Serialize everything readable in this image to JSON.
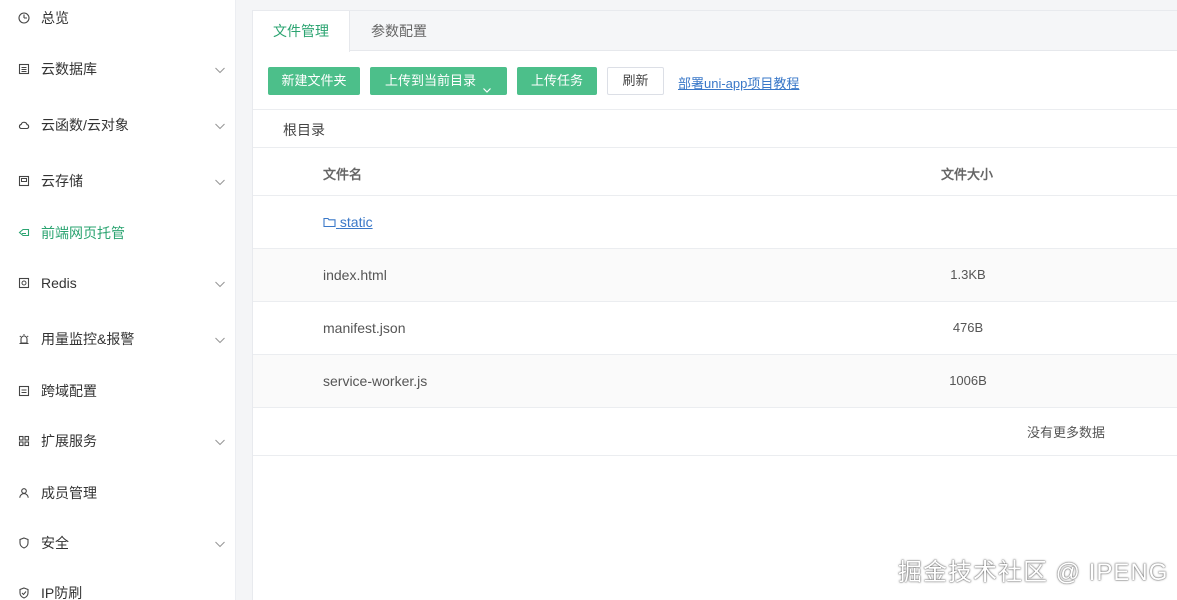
{
  "sidebar": {
    "items": [
      {
        "label": "总览",
        "icon": "clock-icon",
        "expandable": false,
        "active": false
      },
      {
        "label": "云数据库",
        "icon": "database-icon",
        "expandable": true,
        "active": false
      },
      {
        "label": "云函数/云对象",
        "icon": "cloud-icon",
        "expandable": true,
        "active": false
      },
      {
        "label": "云存储",
        "icon": "storage-icon",
        "expandable": true,
        "active": false
      },
      {
        "label": "前端网页托管",
        "icon": "web-hosting-icon",
        "expandable": false,
        "active": true
      },
      {
        "label": "Redis",
        "icon": "redis-icon",
        "expandable": true,
        "active": false
      },
      {
        "label": "用量监控&报警",
        "icon": "alarm-icon",
        "expandable": true,
        "active": false
      },
      {
        "label": "跨域配置",
        "icon": "cors-icon",
        "expandable": false,
        "active": false
      },
      {
        "label": "扩展服务",
        "icon": "grid-icon",
        "expandable": true,
        "active": false
      },
      {
        "label": "成员管理",
        "icon": "user-icon",
        "expandable": false,
        "active": false
      },
      {
        "label": "安全",
        "icon": "shield-icon",
        "expandable": true,
        "active": false
      },
      {
        "label": "IP防刷",
        "icon": "shield-check-icon",
        "expandable": false,
        "active": false
      }
    ]
  },
  "tabs": [
    {
      "label": "文件管理",
      "active": true
    },
    {
      "label": "参数配置",
      "active": false
    }
  ],
  "toolbar": {
    "new_folder": "新建文件夹",
    "upload": "上传到当前目录",
    "upload_tasks": "上传任务",
    "refresh": "刷新",
    "tutorial_link": "部署uni-app项目教程"
  },
  "breadcrumb": "根目录",
  "table": {
    "columns": [
      "文件名",
      "文件大小"
    ],
    "rows": [
      {
        "name": "static",
        "size": "",
        "type": "folder"
      },
      {
        "name": "index.html",
        "size": "1.3KB",
        "type": "file"
      },
      {
        "name": "manifest.json",
        "size": "476B",
        "type": "file"
      },
      {
        "name": "service-worker.js",
        "size": "1006B",
        "type": "file"
      }
    ],
    "empty_text": "没有更多数据"
  },
  "watermark": "掘金技术社区 @ IPENG",
  "colors": {
    "accent": "#2ba471",
    "button_green": "#4cbf8a",
    "link": "#3a78c8"
  }
}
